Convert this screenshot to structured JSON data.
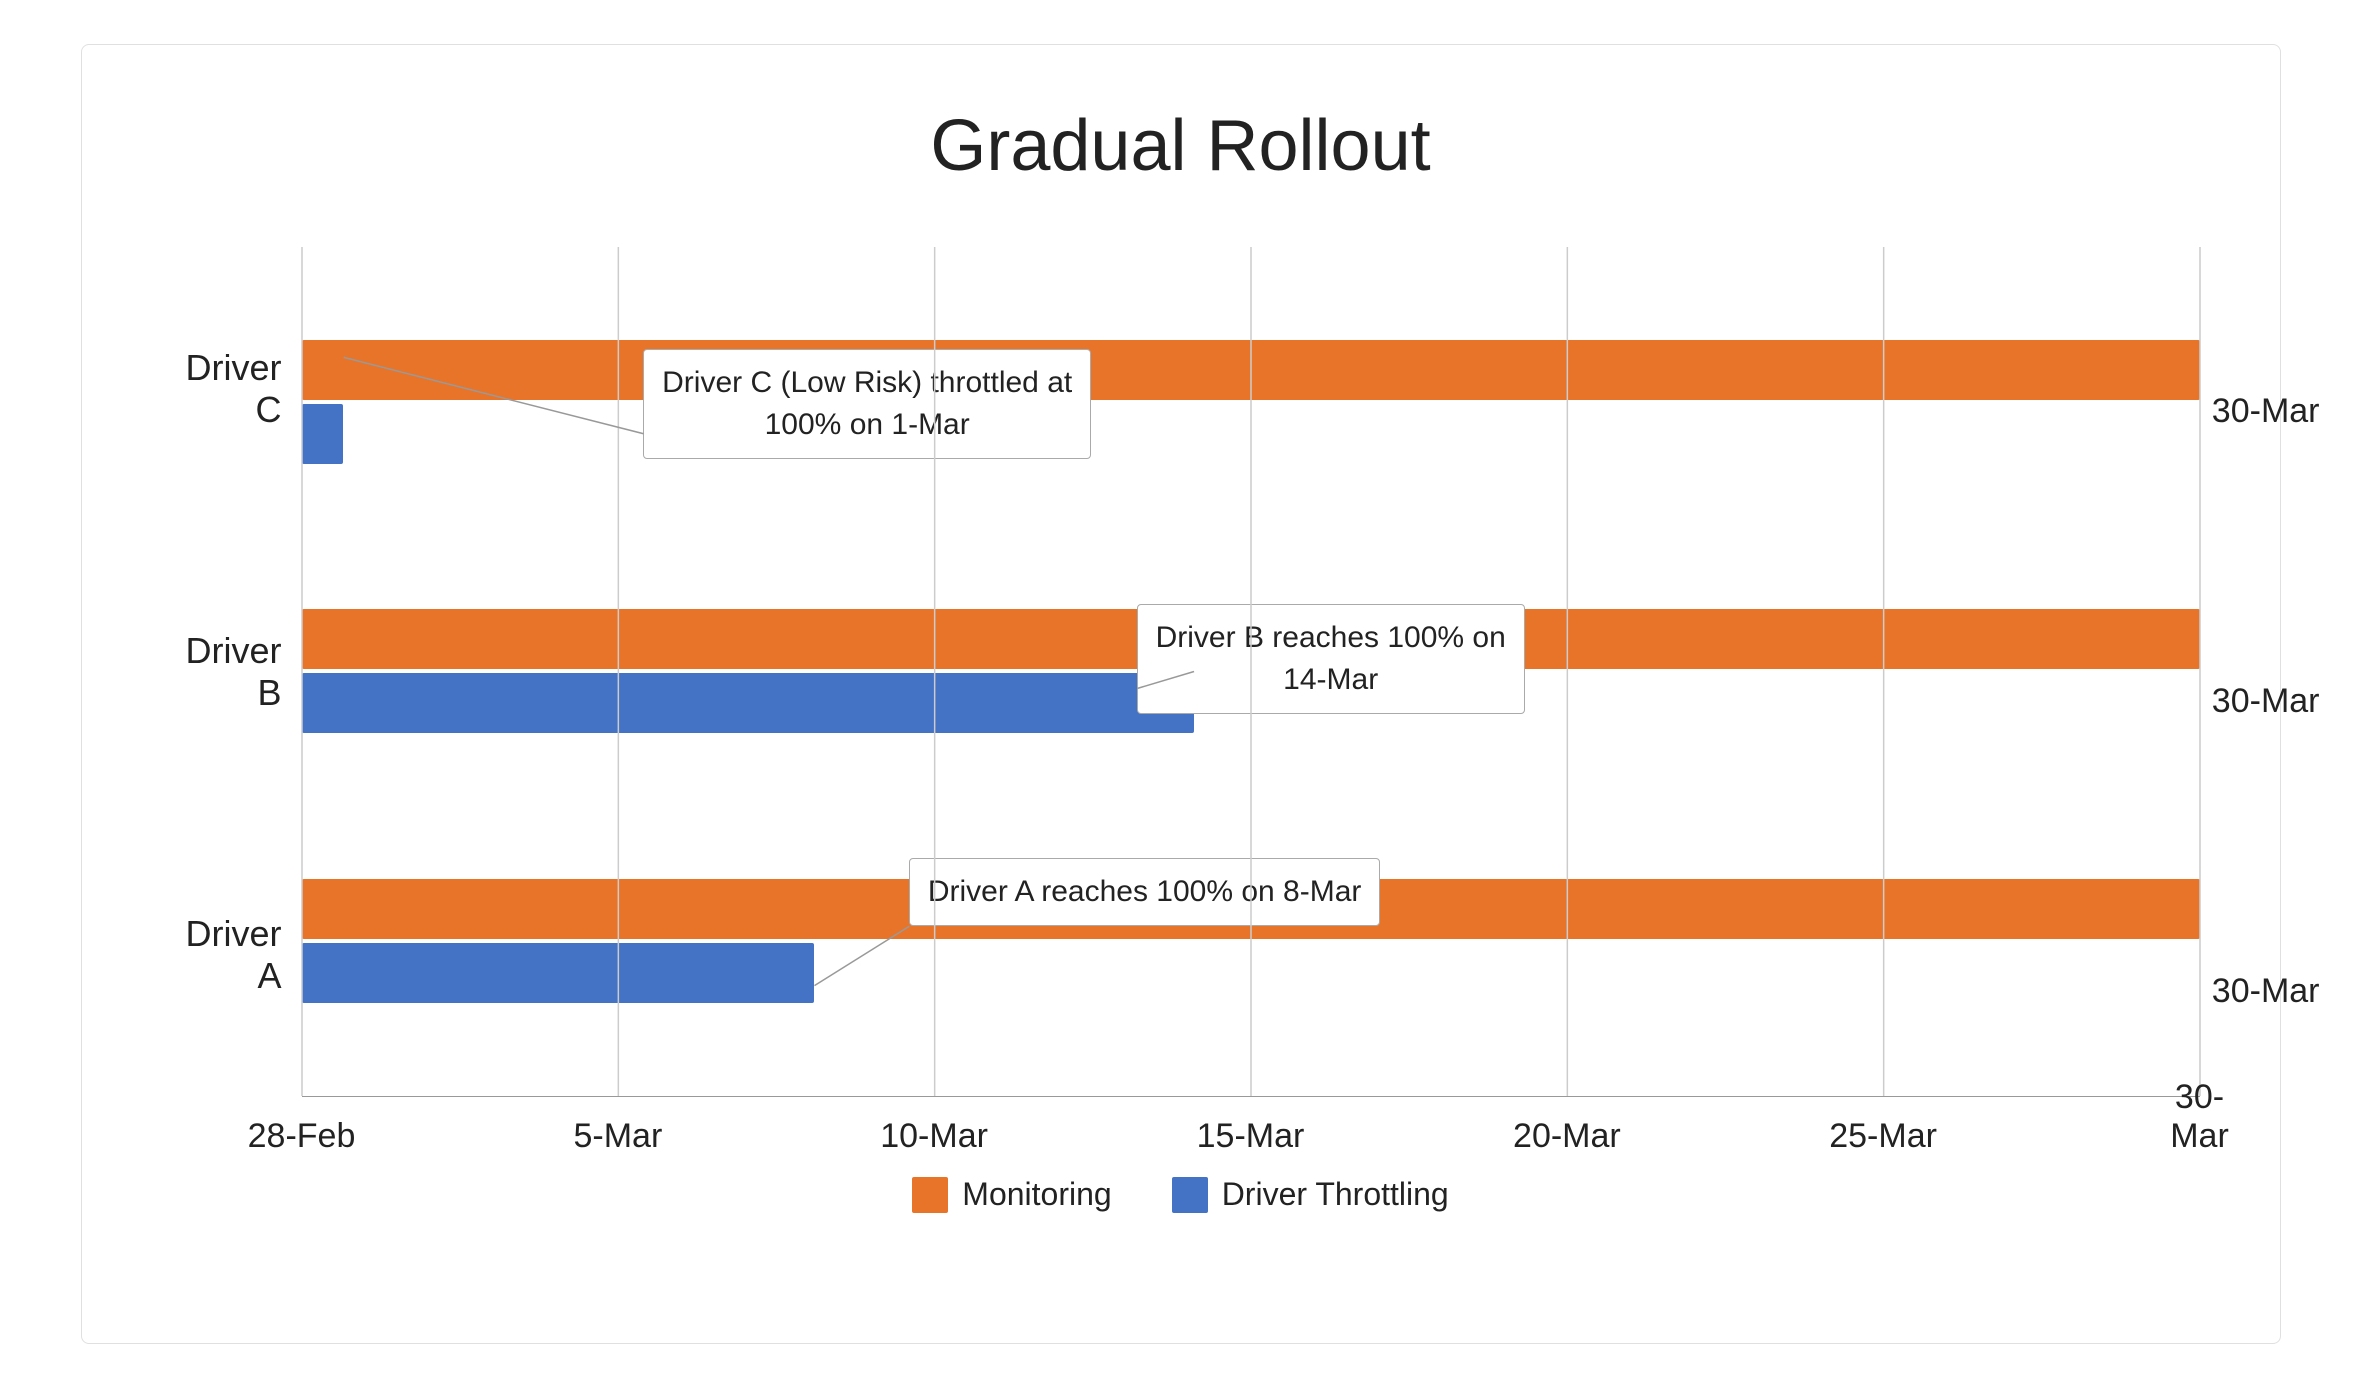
{
  "title": "Gradual Rollout",
  "drivers": [
    "Driver C",
    "Driver B",
    "Driver A"
  ],
  "xAxisLabels": [
    "28-Feb",
    "5-Mar",
    "10-Mar",
    "15-Mar",
    "20-Mar",
    "25-Mar",
    "30-Mar"
  ],
  "rightLabels": [
    "30-Mar",
    "30-Mar",
    "30-Mar"
  ],
  "legend": {
    "items": [
      {
        "label": "Monitoring",
        "color": "#E8742A"
      },
      {
        "label": "Driver Throttling",
        "color": "#4472C4"
      }
    ]
  },
  "annotations": [
    {
      "id": "callout-c",
      "text": "Driver C (Low Risk) throttled at\n100% on 1-Mar",
      "line1": "Driver C (Low Risk) throttled at",
      "line2": "100% on 1-Mar"
    },
    {
      "id": "callout-b",
      "text": "Driver B reaches 100% on\n14-Mar",
      "line1": "Driver B reaches 100% on",
      "line2": "14-Mar"
    },
    {
      "id": "callout-a",
      "text": "Driver A reaches 100% on 8-Mar",
      "line1": "Driver A reaches 100% on 8-Mar",
      "line2": ""
    }
  ],
  "colors": {
    "orange": "#E8742A",
    "blue": "#4472C4",
    "gridLine": "#cccccc",
    "text": "#222222"
  }
}
